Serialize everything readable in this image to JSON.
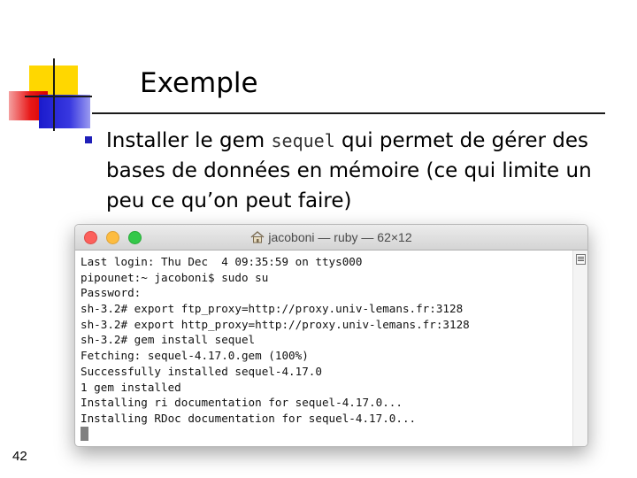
{
  "slide": {
    "title": "Exemple",
    "bullet": {
      "prefix": "Installer le gem ",
      "code": "sequel",
      "suffix": " qui permet de gérer des bases de données en mémoire (ce qui limite un peu ce qu’on peut faire)"
    },
    "page_number": "42",
    "colors": {
      "bullet": "#1f1fb8",
      "logo_yellow": "#ffd700",
      "logo_red": "#e81818",
      "logo_blue": "#2a2ad8"
    }
  },
  "terminal": {
    "window_title": "jacoboni — ruby — 62×12",
    "title_icon": "home-icon",
    "lines": [
      "Last login: Thu Dec  4 09:35:59 on ttys000",
      "pipounet:~ jacoboni$ sudo su",
      "Password:",
      "sh-3.2# export ftp_proxy=http://proxy.univ-lemans.fr:3128",
      "sh-3.2# export http_proxy=http://proxy.univ-lemans.fr:3128",
      "sh-3.2# gem install sequel",
      "Fetching: sequel-4.17.0.gem (100%)",
      "Successfully installed sequel-4.17.0",
      "1 gem installed",
      "Installing ri documentation for sequel-4.17.0...",
      "Installing RDoc documentation for sequel-4.17.0..."
    ]
  }
}
